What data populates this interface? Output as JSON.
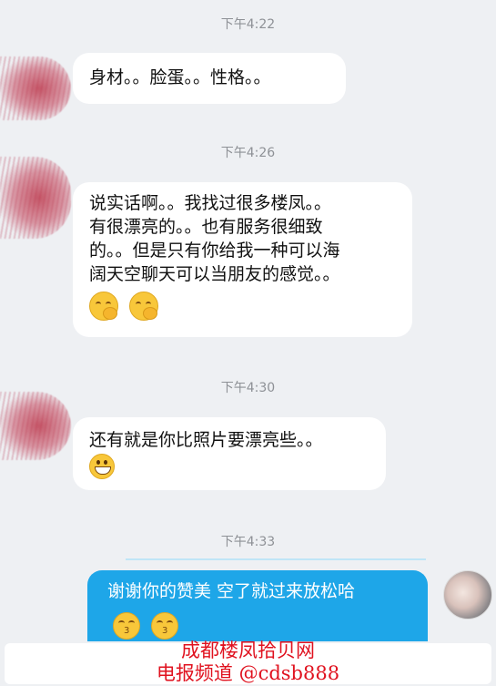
{
  "messages": [
    {
      "time": "下午4:22",
      "lines": [
        "身材。。脸蛋。。性格。。"
      ]
    },
    {
      "time": "下午4:26",
      "lines": [
        "说实话啊。。我找过很多楼凤。。",
        "有很漂亮的。。也有服务很细致",
        "的。。但是只有你给我一种可以海",
        "阔天空聊天可以当朋友的感觉。。"
      ],
      "emoji": "face-with-hand-over-mouth"
    },
    {
      "time": "下午4:30",
      "lines": [
        "还有就是你比照片要漂亮些。。"
      ],
      "emoji": "grinning-face"
    },
    {
      "time": "下午4:33"
    }
  ],
  "reply": {
    "text": "谢谢你的赞美 空了就过来放松哈",
    "emoji": "kissing-face"
  },
  "watermark": {
    "line1": "成都楼凤拾贝网",
    "line2": "电报频道 @cdsb888"
  },
  "colors": {
    "background": "#eef0f3",
    "bubble_incoming": "#ffffff",
    "bubble_outgoing": "#1ea6e8",
    "watermark": "#e0121f",
    "timestamp": "#8e9196"
  }
}
